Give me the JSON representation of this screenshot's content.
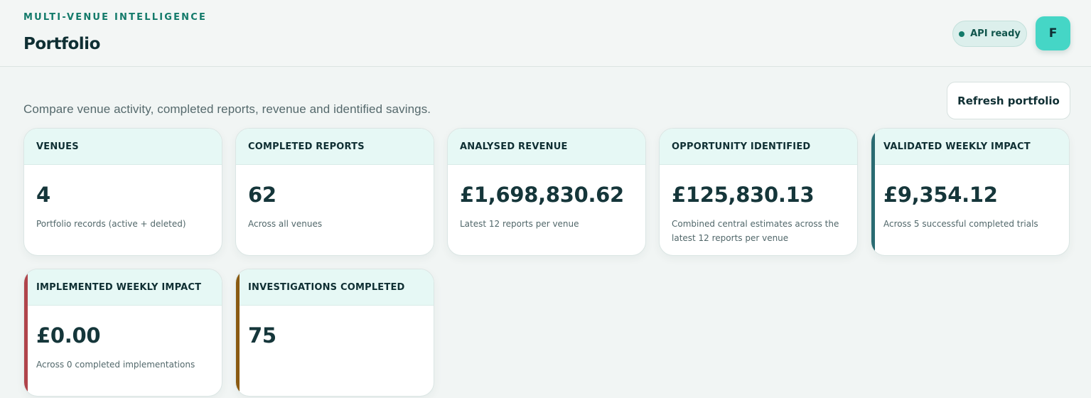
{
  "header": {
    "eyebrow": "MULTI-VENUE INTELLIGENCE",
    "title": "Portfolio",
    "api_status": "API ready",
    "avatar_initial": "F"
  },
  "intro": {
    "subtitle": "Compare venue activity, completed reports, revenue and identified savings.",
    "refresh_label": "Refresh portfolio"
  },
  "colors": {
    "brand": "#137a6a",
    "avatar": "#45d6c6",
    "accent_validated": "#2a6b72",
    "accent_implemented": "#b0444b",
    "accent_investigations": "#8a5a12"
  },
  "cards": [
    {
      "label": "VENUES",
      "value": "4",
      "caption": "Portfolio records (active + deleted)"
    },
    {
      "label": "COMPLETED REPORTS",
      "value": "62",
      "caption": "Across all venues"
    },
    {
      "label": "ANALYSED REVENUE",
      "value": "£1,698,830.62",
      "caption": "Latest 12 reports per venue"
    },
    {
      "label": "OPPORTUNITY IDENTIFIED",
      "value": "£125,830.13",
      "caption": "Combined central estimates across the latest 12 reports per venue"
    },
    {
      "label": "VALIDATED WEEKLY IMPACT",
      "value": "£9,354.12",
      "caption": "Across 5 successful completed trials"
    },
    {
      "label": "IMPLEMENTED WEEKLY IMPACT",
      "value": "£0.00",
      "caption": "Across 0 completed implementations"
    },
    {
      "label": "INVESTIGATIONS COMPLETED",
      "value": "75",
      "caption": ""
    }
  ]
}
